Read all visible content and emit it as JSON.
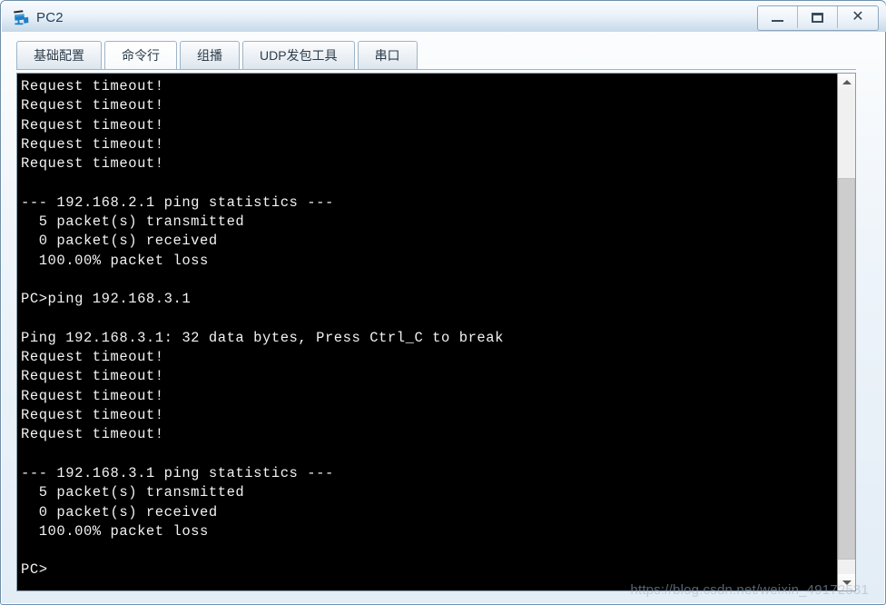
{
  "window": {
    "title": "PC2",
    "icon": "pc-device-icon",
    "controls": [
      {
        "name": "minimize-button",
        "glyph": "minimize"
      },
      {
        "name": "maximize-button",
        "glyph": "maximize"
      },
      {
        "name": "close-button",
        "glyph": "✕"
      }
    ]
  },
  "tabs": [
    {
      "label": "基础配置",
      "active": false
    },
    {
      "label": "命令行",
      "active": true
    },
    {
      "label": "组播",
      "active": false
    },
    {
      "label": "UDP发包工具",
      "active": false
    },
    {
      "label": "串口",
      "active": false
    }
  ],
  "terminal": {
    "background": "#000000",
    "foreground": "#f2f2f2",
    "lines": [
      "Request timeout!",
      "Request timeout!",
      "Request timeout!",
      "Request timeout!",
      "Request timeout!",
      "",
      "--- 192.168.2.1 ping statistics ---",
      "  5 packet(s) transmitted",
      "  0 packet(s) received",
      "  100.00% packet loss",
      "",
      "PC>ping 192.168.3.1",
      "",
      "Ping 192.168.3.1: 32 data bytes, Press Ctrl_C to break",
      "Request timeout!",
      "Request timeout!",
      "Request timeout!",
      "Request timeout!",
      "Request timeout!",
      "",
      "--- 192.168.3.1 ping statistics ---",
      "  5 packet(s) transmitted",
      "  0 packet(s) received",
      "  100.00% packet loss",
      "",
      "PC>"
    ]
  },
  "scrollbar": {
    "up_arrow": "chevron-up-icon",
    "down_arrow": "chevron-down-icon"
  },
  "watermark": {
    "text": "https://blog.csdn.net/weixin_49172531"
  }
}
